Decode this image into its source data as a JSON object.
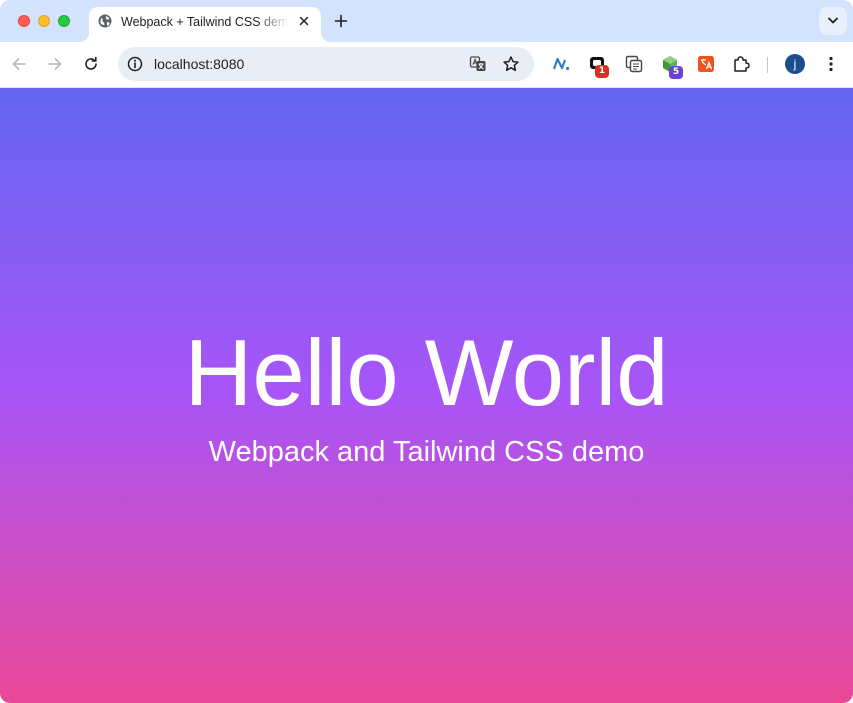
{
  "browser": {
    "tab": {
      "title": "Webpack + Tailwind CSS demo",
      "favicon": "globe-icon"
    },
    "new_tab_label": "+",
    "toolbar": {
      "url": "localhost:8080",
      "extensions": [
        {
          "name": "extension-n-icon"
        },
        {
          "name": "extension-black-icon",
          "badge": "1"
        },
        {
          "name": "extension-copy-icon"
        },
        {
          "name": "extension-green-cube-icon",
          "badge": "5"
        },
        {
          "name": "extension-translate-orange-icon"
        },
        {
          "name": "extensions-puzzle-icon"
        }
      ],
      "profile_initial": "j"
    },
    "colors": {
      "tabstrip": "#d3e3fd",
      "omnibox": "#e9eef6",
      "gradient_top": "#6366f1",
      "gradient_mid": "#a855f7",
      "gradient_bottom": "#ec4899"
    }
  },
  "page": {
    "headline": "Hello World",
    "subtitle": "Webpack and Tailwind CSS demo"
  }
}
